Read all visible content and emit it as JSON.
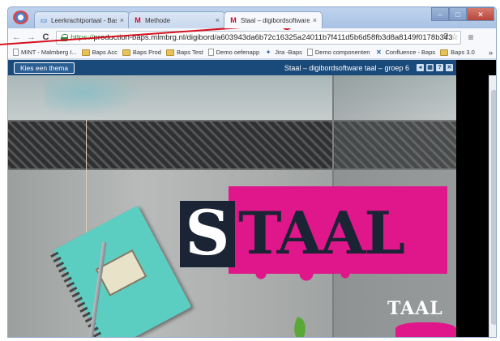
{
  "tabs": [
    {
      "label": "Leerkrachtportaal - Basisp",
      "favicon": "page-icon"
    },
    {
      "label": "Methode",
      "favicon": "m-logo-icon"
    },
    {
      "label": "Staal – digibordsoftware t",
      "favicon": "m-logo-icon"
    }
  ],
  "tab_close": "×",
  "window_controls": {
    "minimize": "–",
    "maximize": "□",
    "close": "✕"
  },
  "address_bar": {
    "scheme": "https://",
    "rest": "production-baps.mlmbrg.nl/digibord/a603943da6b72c16325a24011b7f411d5b6d58fb3d8a8149f0178b343"
  },
  "nav": {
    "back": "←",
    "forward": "→",
    "reload": "C"
  },
  "bookmarks": [
    {
      "label": "MINT - Malmberg I...",
      "icon": "page-icon"
    },
    {
      "label": "Baps Acc",
      "icon": "folder-icon"
    },
    {
      "label": "Baps Prod",
      "icon": "folder-icon"
    },
    {
      "label": "Baps Test",
      "icon": "folder-icon"
    },
    {
      "label": "Demo oefenapp",
      "icon": "page-icon"
    },
    {
      "label": "Jira -Baps",
      "icon": "jira-icon"
    },
    {
      "label": "Demo componenten",
      "icon": "page-icon"
    },
    {
      "label": "Confluence - Baps",
      "icon": "confluence-icon"
    },
    {
      "label": "Baps 3.0",
      "icon": "folder-icon"
    }
  ],
  "bookmarks_more": "»",
  "app": {
    "theme_button": "Kies een thema",
    "title": "Staal – digibordsoftware taal – groep 6",
    "header_icons": [
      "◂",
      "▦",
      "?",
      "✕"
    ]
  },
  "cover": {
    "logo_first": "S",
    "logo_rest": "TAAL",
    "subtitle": "TAAL"
  },
  "colors": {
    "header_blue": "#1a4a7a",
    "brand_pink": "#e0168b",
    "brand_navy": "#1b2435",
    "notebook_teal": "#5ccdc1",
    "annotation_red": "#d4101e"
  }
}
